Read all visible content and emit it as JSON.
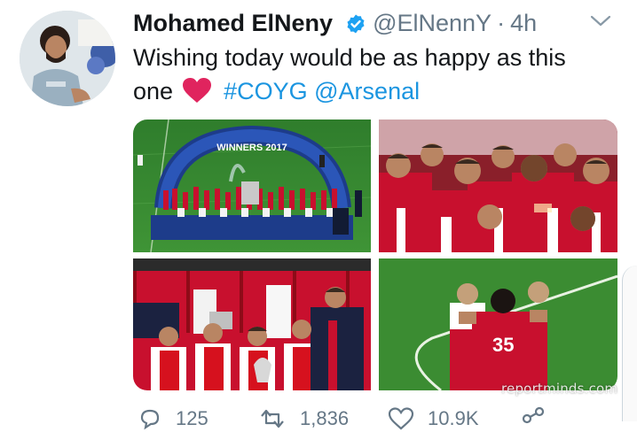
{
  "tweet": {
    "display_name": "Mohamed ElNeny",
    "handle": "@ElNennY",
    "separator": "·",
    "time": "4h",
    "text_main": "Wishing today would be as happy as this one",
    "hashtag": "#COYG",
    "mention": "@Arsenal",
    "banner_text": "WINNERS 2017",
    "watermark": "reportminds.com",
    "counts": {
      "replies": "125",
      "retweets": "1,836",
      "likes": "10.9K"
    }
  },
  "colors": {
    "link": "#1b95e0",
    "verified": "#1da1f2",
    "secondary_text": "#657786",
    "heart": "#e0245e",
    "arsenal_red": "#d6111e"
  },
  "icons": [
    "verified-badge-icon",
    "caret-down-icon",
    "red-heart-emoji-icon",
    "reply-icon",
    "retweet-icon",
    "like-icon",
    "share-icon"
  ]
}
